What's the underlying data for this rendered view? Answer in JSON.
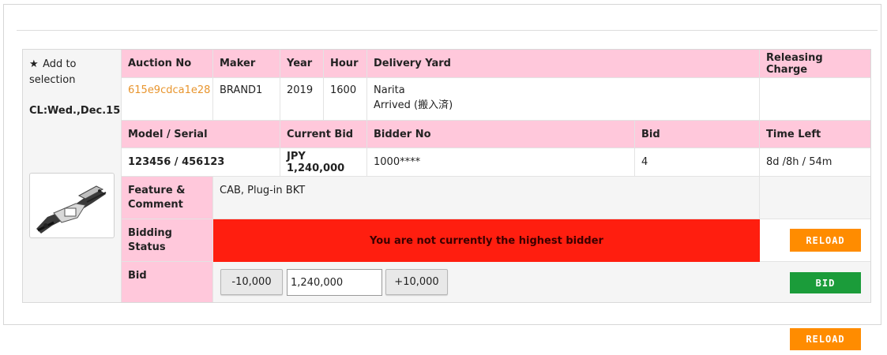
{
  "sidebar": {
    "add_to_selection": "Add to selection",
    "closing": "CL:Wed.,Dec.15",
    "thumbnail_icon": "machine-photo"
  },
  "headers": {
    "auction_no": "Auction No",
    "maker": "Maker",
    "year": "Year",
    "hour": "Hour",
    "delivery_yard": "Delivery Yard",
    "releasing_charge": "Releasing Charge",
    "model_serial": "Model / Serial",
    "current_bid": "Current Bid",
    "bidder_no": "Bidder No",
    "bid": "Bid",
    "time_left": "Time Left",
    "feature_comment": "Feature & Comment",
    "bidding_status": "Bidding Status",
    "bid_row": "Bid"
  },
  "lot": {
    "auction_no": "615e9cdca1e28",
    "maker": "BRAND1",
    "year": "2019",
    "hour": "1600",
    "delivery_yard_line1": "Narita",
    "delivery_yard_line2": "Arrived (搬入済)",
    "releasing_charge": "",
    "model_serial": "123456 / 456123",
    "current_bid": "JPY 1,240,000",
    "bidder_no": "1000****",
    "bid_count": "4",
    "time_left": "8d /8h / 54m",
    "feature_comment": "CAB, Plug-in BKT"
  },
  "status": {
    "message": "You are not currently the highest bidder",
    "color": "#ff1e0f"
  },
  "bidding": {
    "decrement_label": "-10,000",
    "amount_value": "1,240,000",
    "increment_label": "+10,000",
    "bid_button": "BID",
    "reload_button": "RELOAD"
  },
  "footer": {
    "reload_button": "RELOAD"
  },
  "colors": {
    "header_pink": "#ffc8db",
    "accent_orange": "#ff8c00",
    "bid_green": "#1b9c3a",
    "link_orange": "#e8952e"
  }
}
